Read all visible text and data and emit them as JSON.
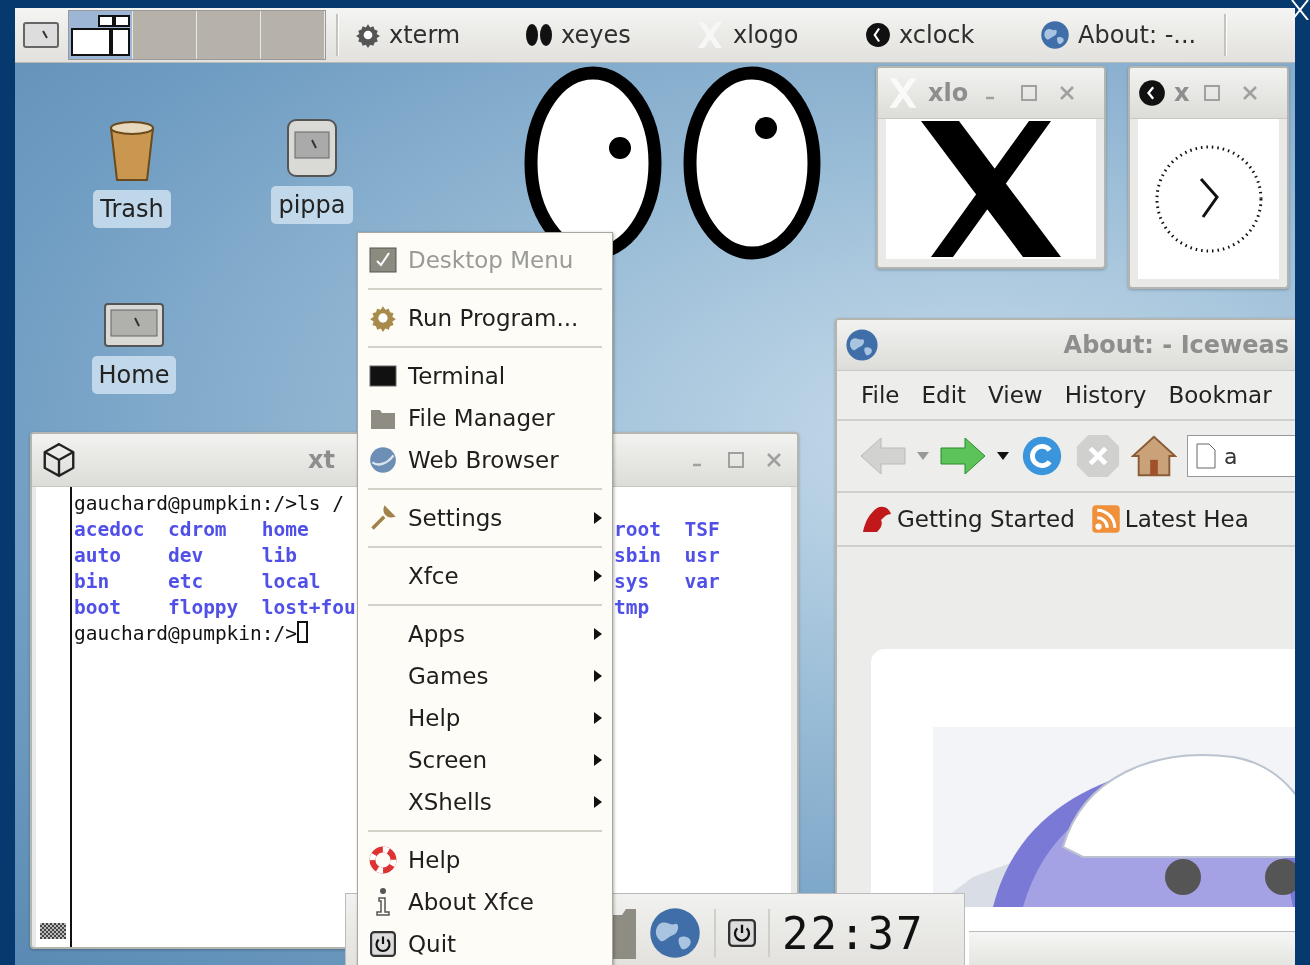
{
  "top_panel": {
    "workspaces": [
      {
        "selected": true
      },
      {
        "selected": false
      },
      {
        "selected": false
      },
      {
        "selected": false
      }
    ],
    "tasks": [
      {
        "label": "xterm"
      },
      {
        "label": "xeyes"
      },
      {
        "label": "xlogo"
      },
      {
        "label": "xclock"
      },
      {
        "label": "About: -..."
      }
    ]
  },
  "desktop_icons": [
    {
      "label": "Trash"
    },
    {
      "label": "pippa"
    },
    {
      "label": "Home"
    }
  ],
  "xlogo_window": {
    "title": "xlo"
  },
  "xclock_window": {
    "title": "x"
  },
  "browser": {
    "title": "About: - Iceweas",
    "menu": [
      "File",
      "Edit",
      "View",
      "History",
      "Bookmar"
    ],
    "address": "a",
    "bookmarks": [
      "Getting Started",
      "Latest Hea"
    ]
  },
  "terminal": {
    "title": "xt",
    "lines": [
      {
        "kind": "prompt",
        "text": "gauchard@pumpkin:/>ls /"
      },
      {
        "kind": "listing",
        "cells": [
          "acedoc",
          "cdrom",
          "home"
        ]
      },
      {
        "kind": "listing",
        "cells": [
          "auto",
          "dev",
          "lib"
        ]
      },
      {
        "kind": "listing",
        "cells": [
          "bin",
          "etc",
          "local"
        ]
      },
      {
        "kind": "listing",
        "cells": [
          "boot",
          "floppy",
          "lost+fou"
        ]
      },
      {
        "kind": "prompt",
        "text": "gauchard@pumpkin:/>",
        "cursor": true
      }
    ],
    "listing_tail": [
      [
        "root",
        "TSF"
      ],
      [
        "sbin",
        "usr"
      ],
      [
        "sys",
        "var"
      ],
      [
        "tmp"
      ]
    ]
  },
  "desktop_menu": {
    "items": [
      {
        "kind": "title",
        "label": "Desktop Menu"
      },
      {
        "kind": "separator"
      },
      {
        "kind": "item",
        "label": "Run Program..."
      },
      {
        "kind": "separator"
      },
      {
        "kind": "item",
        "label": "Terminal"
      },
      {
        "kind": "item",
        "label": "File Manager"
      },
      {
        "kind": "item",
        "label": "Web Browser"
      },
      {
        "kind": "separator"
      },
      {
        "kind": "submenu",
        "label": "Settings"
      },
      {
        "kind": "separator"
      },
      {
        "kind": "submenu",
        "label": "Xfce"
      },
      {
        "kind": "separator"
      },
      {
        "kind": "submenu",
        "label": "Apps"
      },
      {
        "kind": "submenu",
        "label": "Games"
      },
      {
        "kind": "submenu",
        "label": "Help"
      },
      {
        "kind": "submenu",
        "label": "Screen"
      },
      {
        "kind": "submenu",
        "label": "XShells"
      },
      {
        "kind": "separator"
      },
      {
        "kind": "item",
        "label": "Help"
      },
      {
        "kind": "item",
        "label": "About Xfce"
      },
      {
        "kind": "item",
        "label": "Quit"
      }
    ]
  },
  "bottom_panel": {
    "clock": "22:37"
  }
}
